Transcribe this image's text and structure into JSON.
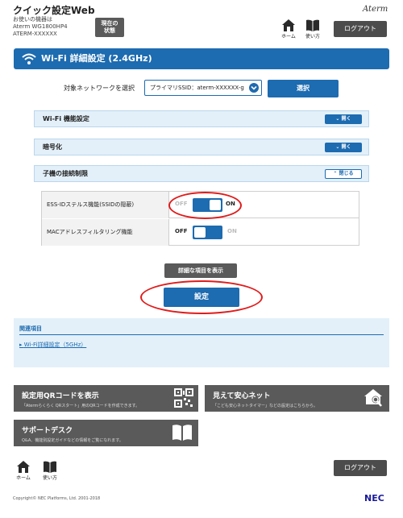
{
  "header": {
    "title": "クイック設定Web",
    "device_label": "お使いの機器は",
    "device_model": "Aterm WG1800HP4",
    "device_name": "ATERM-XXXXXX",
    "state_button": "現在の状態",
    "brand": "Aterm",
    "home_label": "ホーム",
    "guide_label": "使い方",
    "logout_label": "ログアウト"
  },
  "banner": {
    "title": "Wi-Fi 詳細設定 (2.4GHz)"
  },
  "network_select": {
    "label": "対象ネットワークを選択",
    "value": "プライマリSSID：aterm-XXXXXX-g",
    "button": "選択"
  },
  "sections": [
    {
      "label": "Wi-Fi 機能設定",
      "toggle": "開く"
    },
    {
      "label": "暗号化",
      "toggle": "開く"
    },
    {
      "label": "子機の接続制限",
      "toggle": "閉じる"
    }
  ],
  "settings": [
    {
      "label": "ESS-IDステルス機能(SSIDの隠蔽)",
      "off": "OFF",
      "on": "ON",
      "state": "on"
    },
    {
      "label": "MACアドレスフィルタリング機能",
      "off": "OFF",
      "on": "ON",
      "state": "off"
    }
  ],
  "buttons": {
    "detail": "詳細な項目を表示",
    "submit": "設定"
  },
  "related": {
    "title": "関連項目",
    "link": "Wi-Fi詳細設定（5GHz）"
  },
  "tiles": [
    {
      "title": "設定用QRコードを表示",
      "desc": "「Atermらくらく QRスタート」用のQRコードを作成できます。",
      "icon": "qr-code-icon"
    },
    {
      "title": "見えて安心ネット",
      "desc": "「こども安心ネットタイマー」などの設定はこちらから。",
      "icon": "home-search-icon"
    },
    {
      "title": "サポートデスク",
      "desc": "Q&A、機能別設定ガイドなどの情報をご覧になれます。",
      "icon": "book-icon"
    }
  ],
  "footer": {
    "home_label": "ホーム",
    "guide_label": "使い方",
    "logout_label": "ログアウト",
    "copyright": "Copyright© NEC Platforms, Ltd. 2001-2018",
    "brand": "NEC"
  },
  "colors": {
    "accent": "#1d6bb0",
    "highlight": "#e01c1c",
    "tile": "#5a5a5a"
  }
}
